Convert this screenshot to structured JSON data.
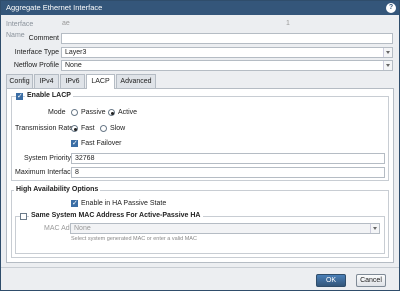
{
  "window": {
    "title": "Aggregate Ethernet Interface"
  },
  "form": {
    "interface_name_label": "Interface Name",
    "interface_name_value": "ae",
    "interface_name_suffix": "1",
    "comment_label": "Comment",
    "comment_value": "",
    "interface_type_label": "Interface Type",
    "interface_type_value": "Layer3",
    "netflow_label": "Netflow Profile",
    "netflow_value": "None"
  },
  "tabs": [
    {
      "label": "Config"
    },
    {
      "label": "IPv4"
    },
    {
      "label": "IPv6"
    },
    {
      "label": "LACP"
    },
    {
      "label": "Advanced"
    }
  ],
  "active_tab": "LACP",
  "lacp": {
    "enable_label": "Enable LACP",
    "enable_checked": true,
    "mode_label": "Mode",
    "mode_options": [
      "Passive",
      "Active"
    ],
    "mode_selected": "Active",
    "rate_label": "Transmission Rate",
    "rate_options": [
      "Fast",
      "Slow"
    ],
    "rate_selected": "Fast",
    "fast_failover_label": "Fast Failover",
    "fast_failover_checked": true,
    "system_priority_label": "System Priority",
    "system_priority_value": "32768",
    "max_interfaces_label": "Maximum Interfaces",
    "max_interfaces_value": "8"
  },
  "ha": {
    "section_label": "High Availability Options",
    "enable_passive_label": "Enable in HA Passive State",
    "enable_passive_checked": true,
    "same_mac_label": "Same System MAC Address For Active-Passive HA",
    "same_mac_checked": false,
    "mac_label": "MAC Address",
    "mac_value": "None",
    "mac_hint": "Select system generated MAC or enter a valid MAC"
  },
  "footer": {
    "ok_label": "OK",
    "cancel_label": "Cancel"
  },
  "colors": {
    "titlebar": "#34567a",
    "accent": "#3b6ea5"
  }
}
